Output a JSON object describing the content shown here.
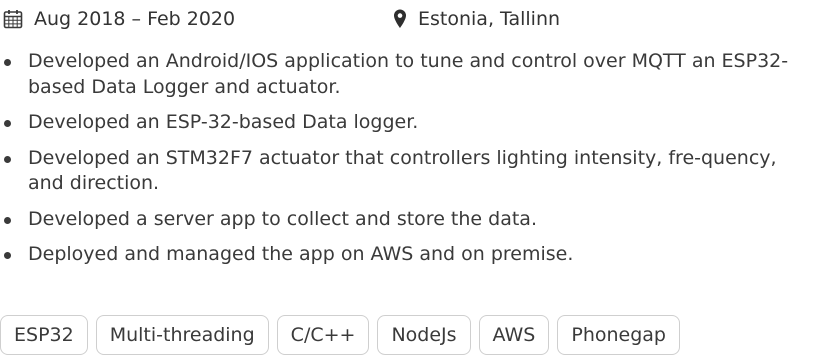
{
  "meta": {
    "date_icon": "calendar-icon",
    "date_range": "Aug 2018 – Feb 2020",
    "location_icon": "map-pin-icon",
    "location": "Estonia, Tallinn"
  },
  "bullets": [
    "Developed an Android/IOS application to tune and control over MQTT an ESP32-based Data Logger and actuator.",
    "Developed an ESP-32-based Data logger.",
    "Developed an STM32F7 actuator that controllers lighting intensity, fre-­quency, and direction.",
    "Developed a server app to collect and store the data.",
    "Deployed and managed the app on AWS and on premise."
  ],
  "tags": [
    "ESP32",
    "Multi-threading",
    "C/C++",
    "NodeJs",
    "AWS",
    "Phonegap"
  ]
}
